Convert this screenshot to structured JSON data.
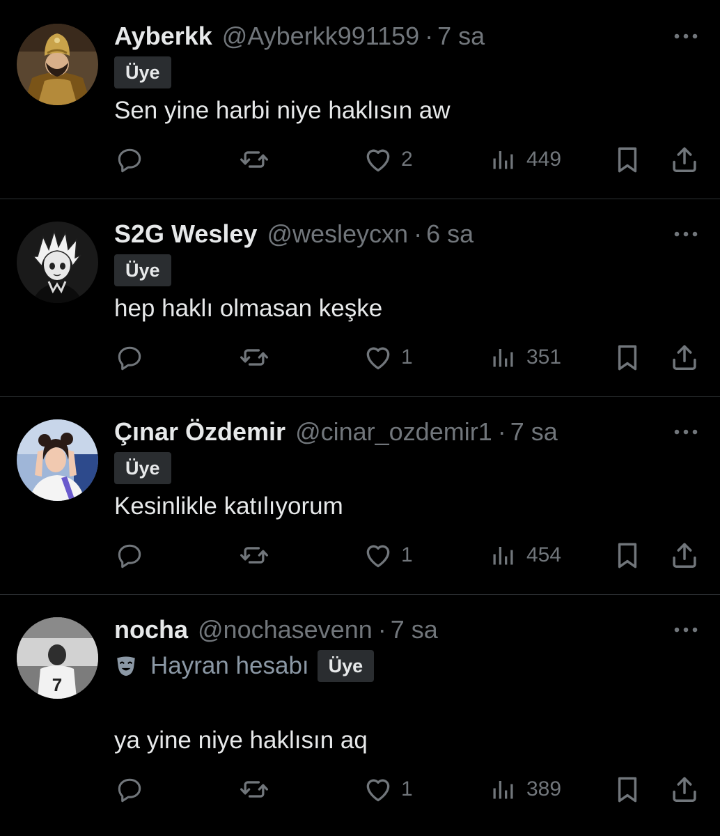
{
  "badge_label": "Üye",
  "replies": [
    {
      "display_name": "Ayberkk",
      "handle": "@Ayberkk991159",
      "separator": "·",
      "time": "7 sa",
      "text": "Sen yine harbi niye haklısın aw",
      "likes": "2",
      "views": "449",
      "avatar_icon": "avatar-ottoman-costume"
    },
    {
      "display_name": "S2G Wesley",
      "handle": "@wesleycxn",
      "separator": "·",
      "time": "6 sa",
      "text": "hep haklı olmasan keşke",
      "likes": "1",
      "views": "351",
      "avatar_icon": "avatar-anime-boy"
    },
    {
      "display_name": "Çınar Özdemir",
      "handle": "@cinar_ozdemir1",
      "separator": "·",
      "time": "7 sa",
      "text": "Kesinlikle katılıyorum",
      "likes": "1",
      "views": "454",
      "avatar_icon": "avatar-girl-photo"
    },
    {
      "display_name": "nocha",
      "handle": "@nochasevenn",
      "separator": "·",
      "time": "7 sa",
      "fan_label": "Hayran hesabı",
      "fan_icon": "theater-mask-icon",
      "text": "ya yine niye haklısın aq",
      "likes": "1",
      "views": "389",
      "avatar_icon": "avatar-jersey-photo"
    }
  ],
  "icons": {
    "reply": "reply-icon",
    "repost": "repost-icon",
    "like": "heart-icon",
    "views": "views-icon",
    "bookmark": "bookmark-icon",
    "share": "share-icon",
    "more": "more-icon"
  },
  "colors": {
    "background": "#000000",
    "text": "#e7e9ea",
    "secondary": "#71767b",
    "divider": "#2f3336",
    "badge_bg": "#2a2d30"
  }
}
